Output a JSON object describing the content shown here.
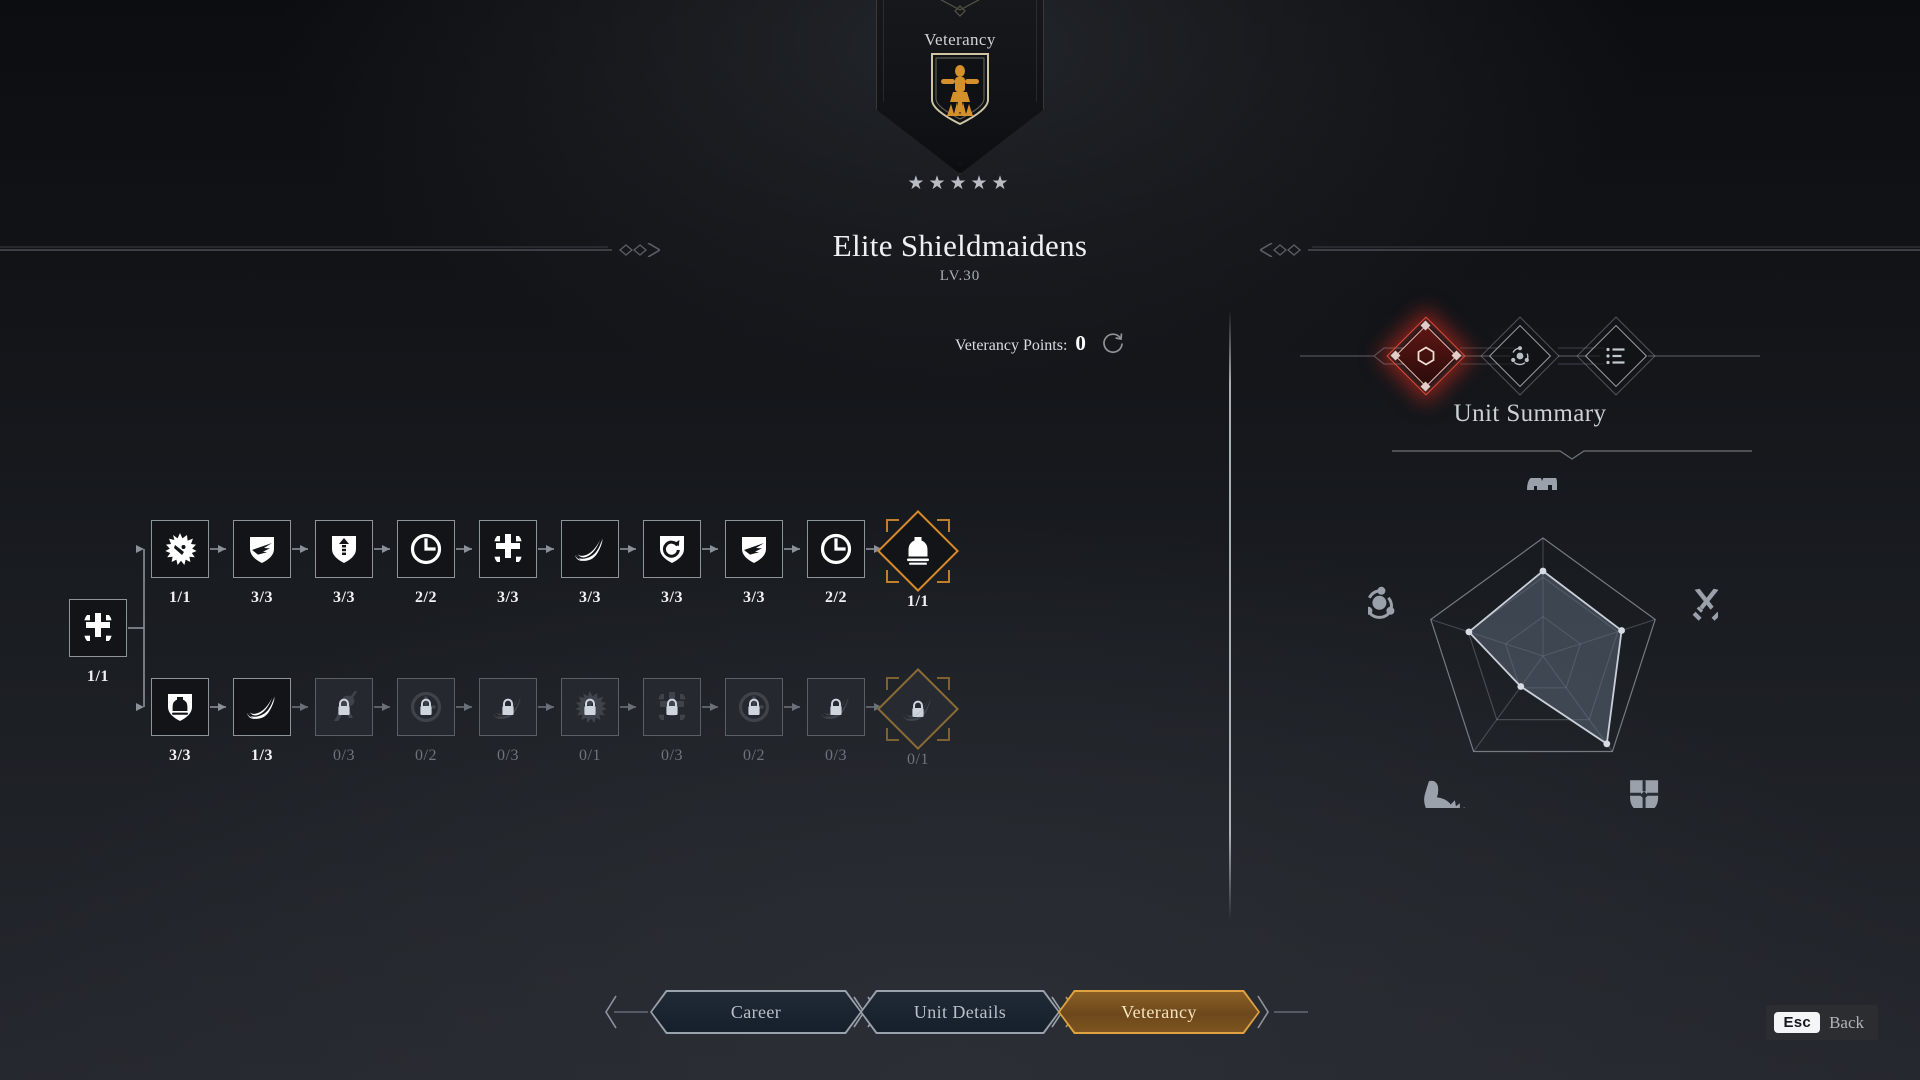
{
  "banner": {
    "title": "Veterancy",
    "crest_icon": "training-dummy-crest",
    "crest_color": "#d4902b"
  },
  "header": {
    "stars": "★★★★★",
    "star_count": 5,
    "unit_name": "Elite Shieldmaidens",
    "level": "LV.30"
  },
  "veterancy_points": {
    "label": "Veterancy Points:",
    "value": "0",
    "reset_icon": "reset-arrow-icon"
  },
  "tree": {
    "root": {
      "icon": "shield-cross-icon",
      "label": "1/1",
      "state": "unlocked"
    },
    "top_row": [
      {
        "icon": "lion-head-icon",
        "label": "1/1",
        "state": "unlocked"
      },
      {
        "icon": "shield-slash-icon",
        "label": "3/3",
        "state": "unlocked"
      },
      {
        "icon": "shield-arrow-up-icon",
        "label": "3/3",
        "state": "unlocked"
      },
      {
        "icon": "clock-icon",
        "label": "2/2",
        "state": "unlocked"
      },
      {
        "icon": "cross-shield-icon",
        "label": "3/3",
        "state": "unlocked"
      },
      {
        "icon": "crescent-claw-icon",
        "label": "3/3",
        "state": "unlocked"
      },
      {
        "icon": "shield-rotate-icon",
        "label": "3/3",
        "state": "unlocked"
      },
      {
        "icon": "shield-slash-icon",
        "label": "3/3",
        "state": "unlocked"
      },
      {
        "icon": "clock-icon",
        "label": "2/2",
        "state": "unlocked"
      },
      {
        "icon": "bell-anvil-icon",
        "label": "1/1",
        "state": "unlocked",
        "capstone": true
      }
    ],
    "bottom_row": [
      {
        "icon": "shield-bell-icon",
        "label": "3/3",
        "state": "unlocked"
      },
      {
        "icon": "crescent-claw-icon",
        "label": "1/3",
        "state": "unlocked"
      },
      {
        "icon": "spearman-icon",
        "label": "0/3",
        "state": "locked"
      },
      {
        "icon": "clock-icon",
        "label": "0/2",
        "state": "locked"
      },
      {
        "icon": "crescent-claw-icon",
        "label": "0/3",
        "state": "locked"
      },
      {
        "icon": "lion-head-icon",
        "label": "0/1",
        "state": "locked"
      },
      {
        "icon": "cross-shield-icon",
        "label": "0/3",
        "state": "locked"
      },
      {
        "icon": "clock-icon",
        "label": "0/2",
        "state": "locked"
      },
      {
        "icon": "crescent-claw-icon",
        "label": "0/3",
        "state": "locked"
      },
      {
        "icon": "crescent-claw-icon",
        "label": "0/1",
        "state": "locked",
        "capstone": true
      }
    ]
  },
  "right_panel": {
    "tabs": [
      {
        "icon": "hexagon-icon",
        "name": "summary-tab",
        "active": true
      },
      {
        "icon": "cohesion-icon",
        "name": "traits-tab",
        "active": false
      },
      {
        "icon": "list-icon",
        "name": "details-tab",
        "active": false
      }
    ],
    "summary_title": "Unit Summary",
    "active_color": "#e04a3a"
  },
  "chart_data": {
    "type": "radar",
    "title": "Unit Summary",
    "categories": [
      "Morale",
      "Melee Attack",
      "Defence",
      "Speed",
      "Cohesion"
    ],
    "category_icons": [
      "helmet-icon",
      "crossed-swords-icon",
      "shield-quarter-icon",
      "boot-icon",
      "cohesion-icon"
    ],
    "values": [
      0.72,
      0.7,
      0.92,
      0.32,
      0.66
    ],
    "max": 1.0,
    "rings": 3,
    "grid": true,
    "legend": false,
    "fill_color": "#5b6878",
    "stroke_color": "#c8cfd8"
  },
  "bottom_tabs": [
    {
      "label": "Career",
      "active": false
    },
    {
      "label": "Unit Details",
      "active": false
    },
    {
      "label": "Veterancy",
      "active": true
    }
  ],
  "back_hint": {
    "key": "Esc",
    "label": "Back"
  }
}
